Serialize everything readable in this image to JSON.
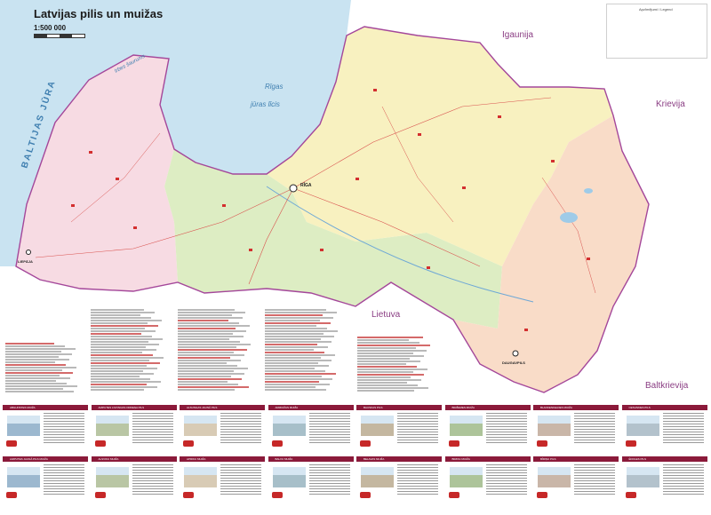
{
  "map": {
    "title": "Latvijas pilis un muižas",
    "scale": "1:500 000",
    "water_labels": {
      "baltic_sea": "BALTIJAS JŪRA",
      "strait": "Irbes šaurums",
      "gulf_line1": "Rīgas",
      "gulf_line2": "jūras līcis"
    },
    "neighbours": {
      "estonia": "Igaunija",
      "russia": "Krievija",
      "lithuania": "Lietuva",
      "belarus": "Baltkrievija"
    },
    "cities": {
      "riga": "RĪGA",
      "liepaja": "LIEPĀJA",
      "daugavpils": "DAUGAVPILS"
    },
    "legend_title": "Apzīmējumi / Legend",
    "colors": {
      "sea": "#c9e3f1",
      "kurzeme": "#f7dbe3",
      "zemgale": "#ddedc3",
      "vidzeme": "#f8f1c0",
      "latgale": "#f9dcc8",
      "border": "#a4479a",
      "neighbour_land": "#ffffff",
      "card_header": "#8b1a3a"
    }
  },
  "cards": [
    {
      "title": "ABGUNSTES MUIŽA"
    },
    {
      "title": "AIZPUTES LIVONIJAS ORDEŅA PILS"
    },
    {
      "title": "ALSUNGAS JAUNĀ PILS"
    },
    {
      "title": "ARMUIŽAS MUIŽA"
    },
    {
      "title": "BAUSKAS PILS"
    },
    {
      "title": "BIRŽEMES MUIŽA"
    },
    {
      "title": "BLANKENFELDES MUIŽA"
    },
    {
      "title": "CESVAINES PILS"
    },
    {
      "title": "AIZPUTES JAUNĀ PILS MUIŽA"
    },
    {
      "title": "ALSVIKU MUIŽA"
    },
    {
      "title": "APRIKU MUIŽA"
    },
    {
      "title": "BALVU MUIŽA"
    },
    {
      "title": "BELAVAS MUIŽA"
    },
    {
      "title": "BIRINU MUIŽA"
    },
    {
      "title": "BĪRIŅU PILS"
    },
    {
      "title": "ĒDOLES PILS"
    }
  ]
}
